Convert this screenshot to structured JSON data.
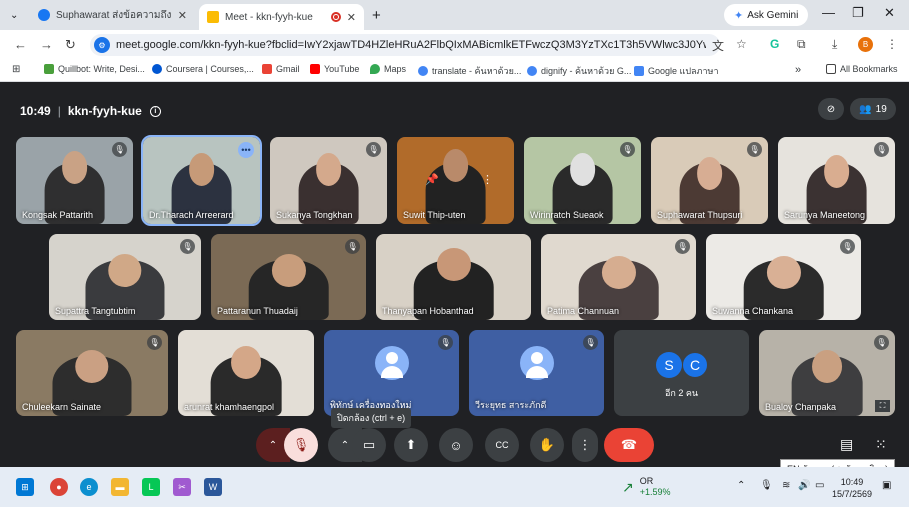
{
  "browser": {
    "tabs": [
      {
        "title": "Suphawarat ส่งข้อความถึง ปรับปรุ",
        "active": false
      },
      {
        "title": "Meet - kkn-fyyh-kue",
        "active": true
      }
    ],
    "gemini_label": "Ask Gemini",
    "url": "meet.google.com/kkn-fyyh-kue?fbclid=IwY2xjawTD4HZleHRuA2FlbQIxMABicmlkETFwczQ3M3YzTXc1T3h5VWlwc3J0YwZhcHBfaWQQ...",
    "profile_initial": "B",
    "bookmarks": [
      "Quillbot: Write, Desi...",
      "Coursera | Courses,...",
      "Gmail",
      "YouTube",
      "Maps",
      "translate - ค้นหาด้วย...",
      "dignify - ค้นหาด้วย G...",
      "Google แปลภาษา"
    ],
    "all_bookmarks": "All Bookmarks"
  },
  "meet": {
    "time": "10:49",
    "meeting_code": "kkn-fyyh-kue",
    "participant_count": "19",
    "participants_row1": [
      "Kongsak Pattarith",
      "Dr.Tharach Arreerard",
      "Sukanya Tongkhan",
      "Suwit Thip-uten",
      "Wirinratch Sueaok",
      "Suphawarat Thupsuri",
      "Sarunya Maneetong"
    ],
    "participants_row2": [
      "Supattra Tangtubtim",
      "Pattaranun Thuadaij",
      "Thanyapan Hobanthad",
      "Patima Channuan",
      "Suwanna Chankana"
    ],
    "participants_row3": [
      "Chuleekarn Sainate",
      "arunrat khamhaengpol",
      "พิทักษ์ เครื่องทองใหม่",
      "วีระยุทธ สาระภักดี",
      "Bualoy Chanpaka"
    ],
    "others_label": "อีก 2 คน",
    "others_initials": [
      "S",
      "C"
    ],
    "tooltip": "ปิดกล้อง (ctrl + e)",
    "language_indicator": "EN อังกฤษ (สหรัฐอเมริกา)"
  },
  "taskbar": {
    "stock_name": "OR",
    "stock_change": "+1.59%",
    "clock_time": "10:49",
    "clock_date": "15/7/2569"
  }
}
